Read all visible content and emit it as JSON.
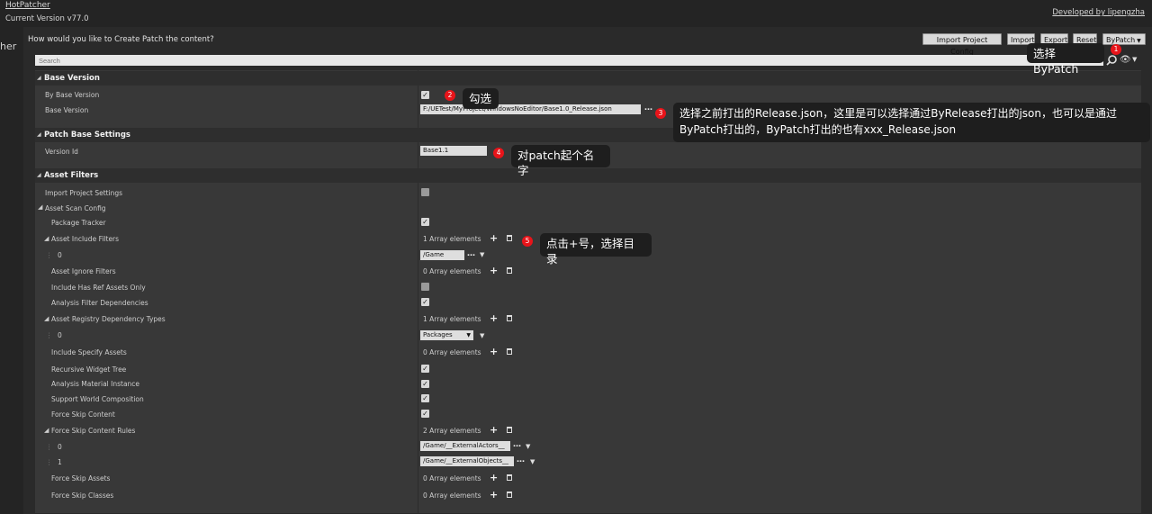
{
  "header": {
    "app_title": "HotPatcher",
    "version": "Current Version v77.0",
    "developer": "Developed by lipengzha",
    "left_edge_text": "her"
  },
  "toolbar": {
    "prompt": "How would you like to Create Patch the content?",
    "import_project_config": "Import Project Config",
    "import": "Import",
    "export": "Export",
    "reset": "Reset",
    "mode": "ByPatch"
  },
  "search": {
    "placeholder": "Search"
  },
  "sections": {
    "base_version": "Base Version",
    "patch_base_settings": "Patch Base Settings",
    "asset_filters": "Asset Filters"
  },
  "rows": {
    "by_base_version": "By Base Version",
    "base_version": "Base Version",
    "base_version_value": "F:/UETest/MyProject/WindowsNoEditor/Base1.0_Release.json",
    "version_id": "Version Id",
    "version_id_value": "Base1.1",
    "import_project_settings": "Import Project Settings",
    "asset_scan_config": "Asset Scan Config",
    "package_tracker": "Package Tracker",
    "asset_include_filters": "Asset Include Filters",
    "asset_include_count": "1 Array elements",
    "index_0": "0",
    "include_value_0": "/Game",
    "asset_ignore_filters": "Asset Ignore Filters",
    "asset_ignore_count": "0 Array elements",
    "include_has_ref": "Include Has Ref Assets Only",
    "analysis_filter_deps": "Analysis Filter Dependencies",
    "registry_dep_types": "Asset Registry Dependency Types",
    "registry_dep_count": "1 Array elements",
    "registry_value_0": "Packages",
    "include_specify": "Include Specify Assets",
    "include_specify_count": "0 Array elements",
    "recursive_widget": "Recursive Widget Tree",
    "analysis_material": "Analysis Material Instance",
    "support_world": "Support World Composition",
    "force_skip_content": "Force Skip Content",
    "force_skip_rules": "Force Skip Content Rules",
    "force_skip_rules_count": "2 Array elements",
    "index_1": "1",
    "skip_rule_0": "/Game/__ExternalActors__",
    "skip_rule_1": "/Game/__ExternalObjects__",
    "force_skip_assets": "Force Skip Assets",
    "force_skip_assets_count": "0 Array elements",
    "force_skip_classes": "Force Skip Classes",
    "force_skip_classes_count": "0 Array elements"
  },
  "annotations": {
    "n1": "1",
    "t1": "选择ByPatch",
    "n2": "2",
    "t2": "勾选",
    "n3": "3",
    "t3": "选择之前打出的Release.json，这里是可以选择通过ByRelease打出的json，也可以是通过ByPatch打出的，ByPatch打出的也有xxx_Release.json",
    "n4": "4",
    "t4": "对patch起个名字",
    "n5": "5",
    "t5": "点击+号，选择目录"
  },
  "icons": {
    "collapse": "triangle-down-icon",
    "check": "check-icon",
    "plus": "plus-icon",
    "trash": "trash-icon",
    "search": "magnifier-icon",
    "eye": "eye-icon"
  },
  "colors": {
    "badge": "#e8141a",
    "tooltip": "#1e1e1e"
  }
}
